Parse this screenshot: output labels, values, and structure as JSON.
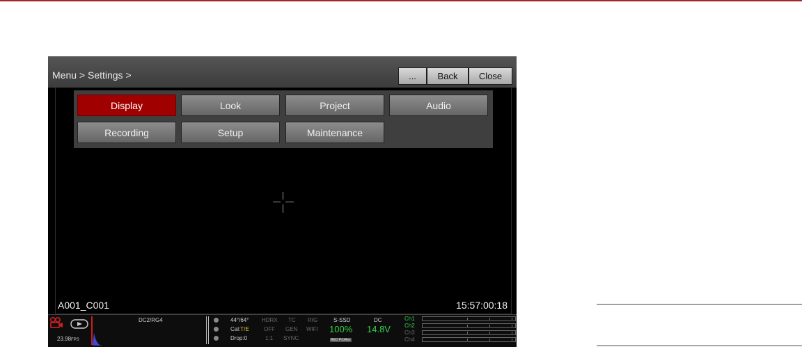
{
  "page": {
    "accent_color": "#a3262a"
  },
  "titlebar": {
    "breadcrumb": "Menu > Settings >",
    "more_label": "...",
    "back_label": "Back",
    "close_label": "Close"
  },
  "menu": {
    "items": [
      {
        "label": "Display",
        "active": true
      },
      {
        "label": "Look",
        "active": false
      },
      {
        "label": "Project",
        "active": false
      },
      {
        "label": "Audio",
        "active": false
      },
      {
        "label": "Recording",
        "active": false
      },
      {
        "label": "Setup",
        "active": false
      },
      {
        "label": "Maintenance",
        "active": false
      }
    ],
    "active_color": "#a10000"
  },
  "viewport": {
    "clip_name": "A001_C001",
    "timecode": "15:57:00:18"
  },
  "statusbar": {
    "fps": "23.98",
    "fps_unit": "FPS",
    "codec": "DC2/RG4",
    "temp": "44°/64°",
    "cal_label": "Cal:",
    "cal_value": "T/E",
    "drop": "Drop:0",
    "hdrx_label": "HDRX",
    "hdrx_value": "OFF",
    "hdrx_ratio": "1:1",
    "tc_label": "TC",
    "tc_value": "GEN",
    "tc_sync": "SYNC",
    "rig_label": "RIG",
    "rig_value": "WIFI",
    "media_label": "S-SSD",
    "media_value": "100%",
    "media_badges": [
      "RED",
      "ProRes"
    ],
    "power_label": "DC",
    "power_value": "14.8V",
    "channels": [
      "Ch1",
      "Ch2",
      "Ch3",
      "Ch4"
    ],
    "green_color": "#34d24a"
  }
}
